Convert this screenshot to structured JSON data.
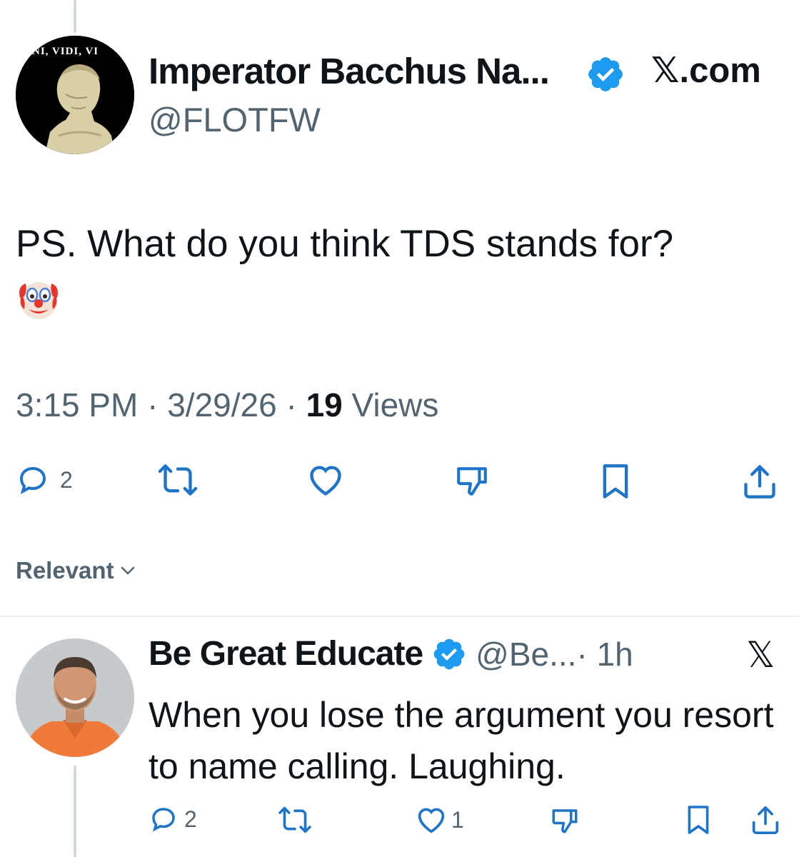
{
  "main_tweet": {
    "avatar_motto": "ENI, VIDI, VI",
    "display_name": "Imperator Bacchus Na...",
    "handle": "@FLOTFW",
    "source": "X.com",
    "source_x": "𝕏",
    "source_suffix": ".com",
    "text": "PS. What do you think TDS stands for?",
    "emoji": "clown-face",
    "time": "3:15 PM",
    "date": "3/29/26",
    "separator": "·",
    "views_count": "19",
    "views_label": "Views",
    "actions": {
      "reply_count": "2",
      "repost_count": "",
      "like_count": "",
      "dislike_count": "",
      "bookmark_count": ""
    }
  },
  "replies_sort": {
    "label": "Relevant"
  },
  "reply": {
    "display_name": "Be Great Educate",
    "handle": "@Be...",
    "age": "· 1h",
    "menu_glyph": "𝕏",
    "text": "When you lose the argument you resort to name calling. Laughing.",
    "actions": {
      "reply_count": "2",
      "like_count": "1"
    }
  },
  "colors": {
    "text_primary": "#0f1419",
    "text_secondary": "#536471",
    "verified_blue": "#1d9bf0",
    "divider": "#eff3f4",
    "thread_line": "#cfd9de"
  }
}
